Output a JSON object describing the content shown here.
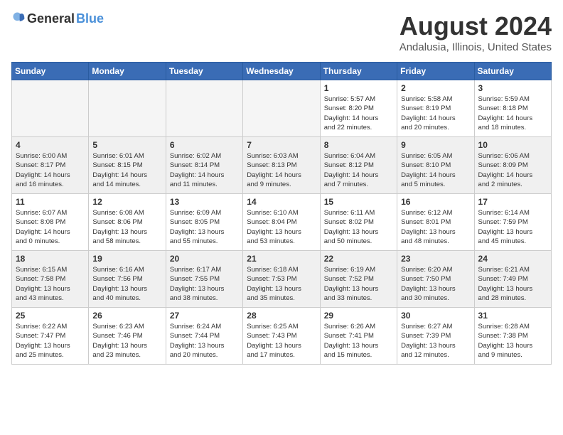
{
  "header": {
    "logo_general": "General",
    "logo_blue": "Blue",
    "title": "August 2024",
    "location": "Andalusia, Illinois, United States"
  },
  "weekdays": [
    "Sunday",
    "Monday",
    "Tuesday",
    "Wednesday",
    "Thursday",
    "Friday",
    "Saturday"
  ],
  "weeks": [
    [
      {
        "day": "",
        "info": ""
      },
      {
        "day": "",
        "info": ""
      },
      {
        "day": "",
        "info": ""
      },
      {
        "day": "",
        "info": ""
      },
      {
        "day": "1",
        "info": "Sunrise: 5:57 AM\nSunset: 8:20 PM\nDaylight: 14 hours\nand 22 minutes."
      },
      {
        "day": "2",
        "info": "Sunrise: 5:58 AM\nSunset: 8:19 PM\nDaylight: 14 hours\nand 20 minutes."
      },
      {
        "day": "3",
        "info": "Sunrise: 5:59 AM\nSunset: 8:18 PM\nDaylight: 14 hours\nand 18 minutes."
      }
    ],
    [
      {
        "day": "4",
        "info": "Sunrise: 6:00 AM\nSunset: 8:17 PM\nDaylight: 14 hours\nand 16 minutes."
      },
      {
        "day": "5",
        "info": "Sunrise: 6:01 AM\nSunset: 8:15 PM\nDaylight: 14 hours\nand 14 minutes."
      },
      {
        "day": "6",
        "info": "Sunrise: 6:02 AM\nSunset: 8:14 PM\nDaylight: 14 hours\nand 11 minutes."
      },
      {
        "day": "7",
        "info": "Sunrise: 6:03 AM\nSunset: 8:13 PM\nDaylight: 14 hours\nand 9 minutes."
      },
      {
        "day": "8",
        "info": "Sunrise: 6:04 AM\nSunset: 8:12 PM\nDaylight: 14 hours\nand 7 minutes."
      },
      {
        "day": "9",
        "info": "Sunrise: 6:05 AM\nSunset: 8:10 PM\nDaylight: 14 hours\nand 5 minutes."
      },
      {
        "day": "10",
        "info": "Sunrise: 6:06 AM\nSunset: 8:09 PM\nDaylight: 14 hours\nand 2 minutes."
      }
    ],
    [
      {
        "day": "11",
        "info": "Sunrise: 6:07 AM\nSunset: 8:08 PM\nDaylight: 14 hours\nand 0 minutes."
      },
      {
        "day": "12",
        "info": "Sunrise: 6:08 AM\nSunset: 8:06 PM\nDaylight: 13 hours\nand 58 minutes."
      },
      {
        "day": "13",
        "info": "Sunrise: 6:09 AM\nSunset: 8:05 PM\nDaylight: 13 hours\nand 55 minutes."
      },
      {
        "day": "14",
        "info": "Sunrise: 6:10 AM\nSunset: 8:04 PM\nDaylight: 13 hours\nand 53 minutes."
      },
      {
        "day": "15",
        "info": "Sunrise: 6:11 AM\nSunset: 8:02 PM\nDaylight: 13 hours\nand 50 minutes."
      },
      {
        "day": "16",
        "info": "Sunrise: 6:12 AM\nSunset: 8:01 PM\nDaylight: 13 hours\nand 48 minutes."
      },
      {
        "day": "17",
        "info": "Sunrise: 6:14 AM\nSunset: 7:59 PM\nDaylight: 13 hours\nand 45 minutes."
      }
    ],
    [
      {
        "day": "18",
        "info": "Sunrise: 6:15 AM\nSunset: 7:58 PM\nDaylight: 13 hours\nand 43 minutes."
      },
      {
        "day": "19",
        "info": "Sunrise: 6:16 AM\nSunset: 7:56 PM\nDaylight: 13 hours\nand 40 minutes."
      },
      {
        "day": "20",
        "info": "Sunrise: 6:17 AM\nSunset: 7:55 PM\nDaylight: 13 hours\nand 38 minutes."
      },
      {
        "day": "21",
        "info": "Sunrise: 6:18 AM\nSunset: 7:53 PM\nDaylight: 13 hours\nand 35 minutes."
      },
      {
        "day": "22",
        "info": "Sunrise: 6:19 AM\nSunset: 7:52 PM\nDaylight: 13 hours\nand 33 minutes."
      },
      {
        "day": "23",
        "info": "Sunrise: 6:20 AM\nSunset: 7:50 PM\nDaylight: 13 hours\nand 30 minutes."
      },
      {
        "day": "24",
        "info": "Sunrise: 6:21 AM\nSunset: 7:49 PM\nDaylight: 13 hours\nand 28 minutes."
      }
    ],
    [
      {
        "day": "25",
        "info": "Sunrise: 6:22 AM\nSunset: 7:47 PM\nDaylight: 13 hours\nand 25 minutes."
      },
      {
        "day": "26",
        "info": "Sunrise: 6:23 AM\nSunset: 7:46 PM\nDaylight: 13 hours\nand 23 minutes."
      },
      {
        "day": "27",
        "info": "Sunrise: 6:24 AM\nSunset: 7:44 PM\nDaylight: 13 hours\nand 20 minutes."
      },
      {
        "day": "28",
        "info": "Sunrise: 6:25 AM\nSunset: 7:43 PM\nDaylight: 13 hours\nand 17 minutes."
      },
      {
        "day": "29",
        "info": "Sunrise: 6:26 AM\nSunset: 7:41 PM\nDaylight: 13 hours\nand 15 minutes."
      },
      {
        "day": "30",
        "info": "Sunrise: 6:27 AM\nSunset: 7:39 PM\nDaylight: 13 hours\nand 12 minutes."
      },
      {
        "day": "31",
        "info": "Sunrise: 6:28 AM\nSunset: 7:38 PM\nDaylight: 13 hours\nand 9 minutes."
      }
    ]
  ]
}
